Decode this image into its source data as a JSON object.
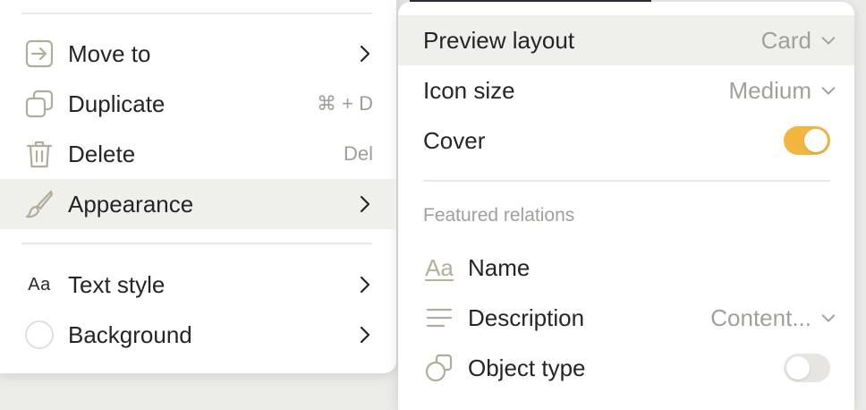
{
  "left_menu": {
    "items": [
      {
        "label": "Move to",
        "icon": "move-to-icon"
      },
      {
        "label": "Duplicate",
        "icon": "duplicate-icon",
        "shortcut": "⌘ + D"
      },
      {
        "label": "Delete",
        "icon": "trash-icon",
        "shortcut": "Del"
      },
      {
        "label": "Appearance",
        "icon": "brush-icon"
      },
      {
        "label": "Text style",
        "icon": "text-style-icon",
        "icon_text": "Aa"
      },
      {
        "label": "Background",
        "icon": "background-circle-icon"
      }
    ]
  },
  "appearance_menu": {
    "preview_layout": {
      "label": "Preview layout",
      "value": "Card"
    },
    "icon_size": {
      "label": "Icon size",
      "value": "Medium"
    },
    "cover": {
      "label": "Cover",
      "enabled": true
    },
    "featured_relations": {
      "title": "Featured relations",
      "items": [
        {
          "label": "Name",
          "icon": "text-relation-icon",
          "icon_text": "Aa"
        },
        {
          "label": "Description",
          "icon": "lines-icon",
          "value": "Content..."
        },
        {
          "label": "Object type",
          "icon": "object-type-icon",
          "enabled": false
        }
      ]
    }
  },
  "colors": {
    "toggle_on": "#f2b53f",
    "toggle_off": "#e6e5df",
    "active_row": "#efefec",
    "muted_text": "#a0a09a"
  }
}
